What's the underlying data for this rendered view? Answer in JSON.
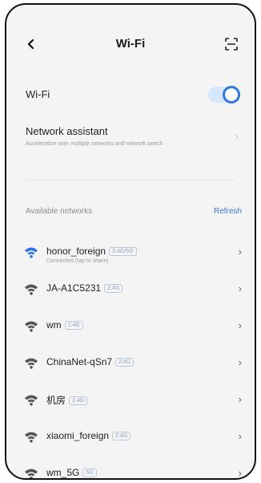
{
  "header": {
    "title": "Wi-Fi",
    "back_icon": "chevron-left-icon",
    "scan_icon": "scan-icon"
  },
  "wifi_toggle": {
    "label": "Wi-Fi",
    "state": "on",
    "accent": "#2f78e3"
  },
  "assistant": {
    "label": "Network assistant",
    "description": "Acceleration over multiple networks and network switch"
  },
  "section": {
    "label": "Available networks",
    "refresh_label": "Refresh"
  },
  "networks": [
    {
      "ssid": "honor_foreign",
      "band": "2.4G/5G",
      "status": "Connected (tap to share)"
    },
    {
      "ssid": "JA-A1C5231",
      "band": "2.4G"
    },
    {
      "ssid": "wm",
      "band": "2.4G"
    },
    {
      "ssid": "ChinaNet-qSn7",
      "band": "2.4G"
    },
    {
      "ssid": "机房",
      "band": "2.4G"
    },
    {
      "ssid": "xiaomi_foreign",
      "band": "2.4G"
    },
    {
      "ssid": "wm_5G",
      "band": "5G"
    }
  ]
}
